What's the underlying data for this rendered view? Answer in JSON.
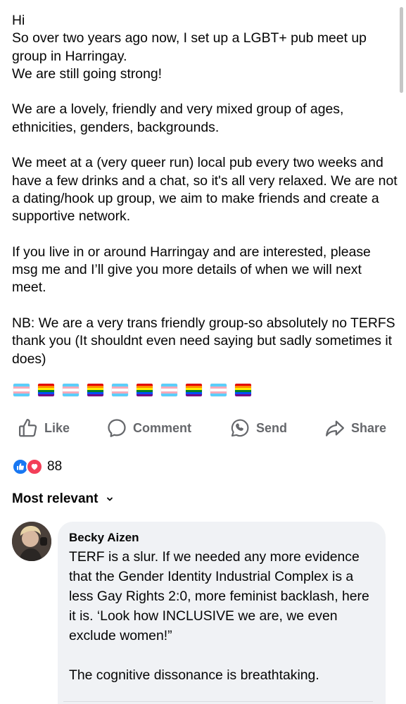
{
  "post": {
    "text": "Hi\nSo over two years ago now, I set up a LGBT+ pub meet up group in Harringay.\nWe are still going strong!\n\nWe are a lovely, friendly and very mixed group of ages, ethnicities, genders, backgrounds.\n\nWe meet at a (very queer run) local pub every two weeks and have a few drinks and a chat, so it's all very relaxed. We are not a dating/hook up group, we aim to make friends and create a supportive network.\n\nIf you live in or around Harringay and are interested, please msg me and I’ll give you more details of when we will next meet.\n\nNB: We are a very trans friendly group-so absolutely no TERFS thank you (It shouldnt even need saying but sadly sometimes it does)",
    "flags": [
      "transgender-flag",
      "rainbow-flag",
      "transgender-flag",
      "rainbow-flag",
      "transgender-flag",
      "rainbow-flag",
      "transgender-flag",
      "rainbow-flag",
      "transgender-flag",
      "rainbow-flag"
    ]
  },
  "actions": {
    "like_label": "Like",
    "comment_label": "Comment",
    "send_label": "Send",
    "share_label": "Share"
  },
  "reactions": {
    "count": "88",
    "types": [
      "like",
      "love"
    ]
  },
  "comments_sort": {
    "label": "Most relevant"
  },
  "comment": {
    "author": "Becky Aizen",
    "text": "TERF is a slur. If we needed any more evidence that the Gender Identity Industrial Complex is a less Gay Rights 2:0, more feminist backlash, here it is. ‘Look how INCLUSIVE we are, we even exclude women!”\n\nThe cognitive dissonance is breathtaking."
  },
  "colors": {
    "action_grey": "#65676b",
    "like_blue": "#1877f2",
    "love_red": "#f33e58",
    "bubble_bg": "#f0f2f5"
  }
}
